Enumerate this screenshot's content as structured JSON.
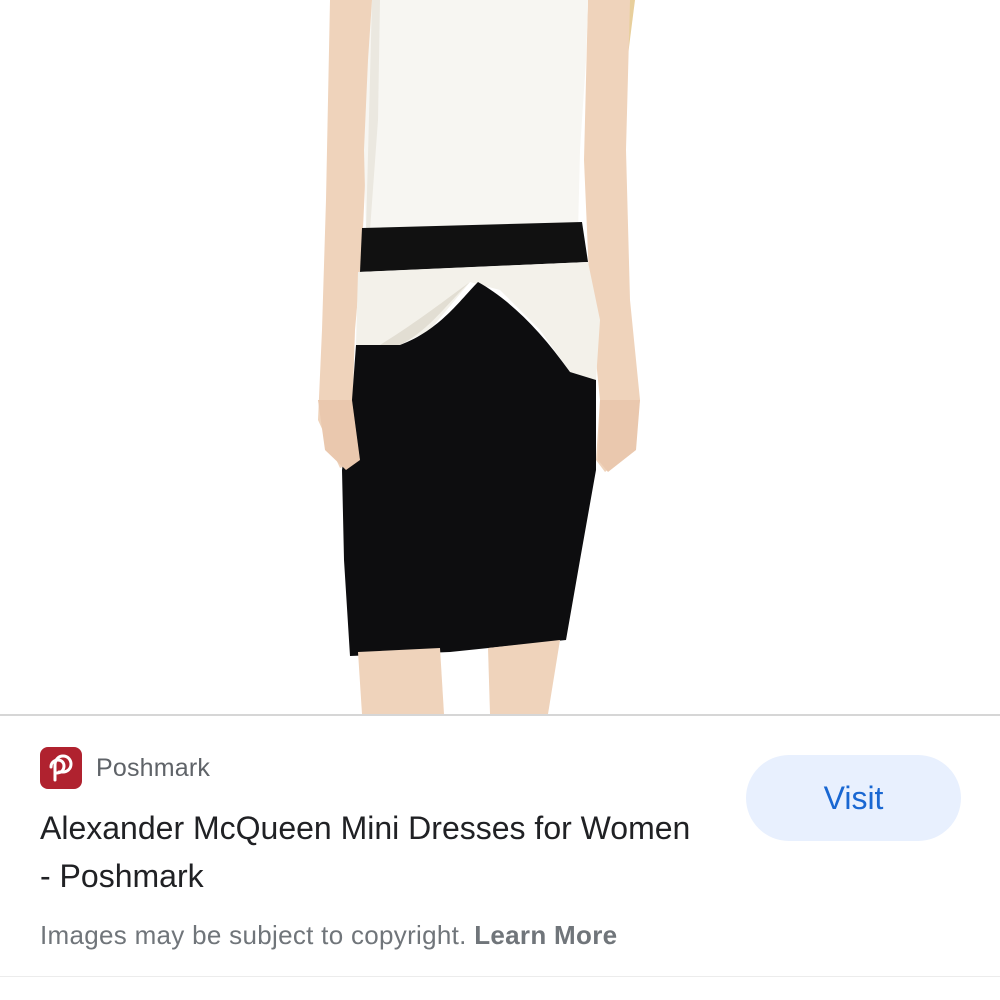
{
  "source": {
    "name": "Poshmark",
    "favicon_icon": "poshmark-logo-icon",
    "favicon_color": "#b0222f"
  },
  "result": {
    "title": "Alexander McQueen Mini Dresses for Women - Poshmark"
  },
  "visit_button": {
    "label": "Visit",
    "background": "#e8f0fe",
    "text_color": "#1967d2"
  },
  "copyright": {
    "text": "Images may be subject to copyright.",
    "link_label": "Learn More"
  }
}
